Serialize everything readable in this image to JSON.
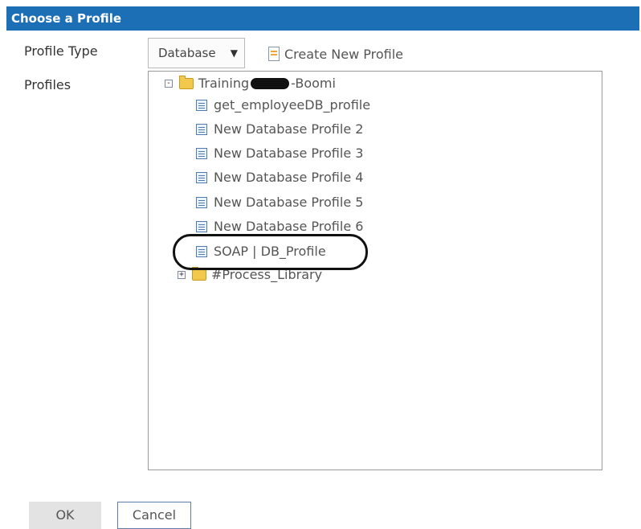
{
  "dialog": {
    "title": "Choose a Profile"
  },
  "form": {
    "profile_type_label": "Profile Type",
    "profiles_label": "Profiles",
    "profile_type_value": "Database",
    "create_new_label": "Create New Profile"
  },
  "tree": {
    "root": {
      "prefix": "Training",
      "suffix": "-Boomi",
      "expanded": true
    },
    "items": [
      {
        "label": "get_employeeDB_profile"
      },
      {
        "label": "New Database Profile 2"
      },
      {
        "label": "New Database Profile 3"
      },
      {
        "label": "New Database Profile 4"
      },
      {
        "label": "New Database Profile 5"
      },
      {
        "label": "New Database Profile 6"
      },
      {
        "label": "SOAP | DB_Profile",
        "highlighted": true
      }
    ],
    "library": {
      "label": "#Process_Library",
      "expanded": false
    }
  },
  "buttons": {
    "ok": "OK",
    "cancel": "Cancel"
  },
  "colors": {
    "titlebar": "#1d6fb5",
    "highlight_outline": "#111111"
  },
  "icons": {
    "expander_open": "⊟",
    "expander_closed": "⊞",
    "chevron": "⌄"
  }
}
